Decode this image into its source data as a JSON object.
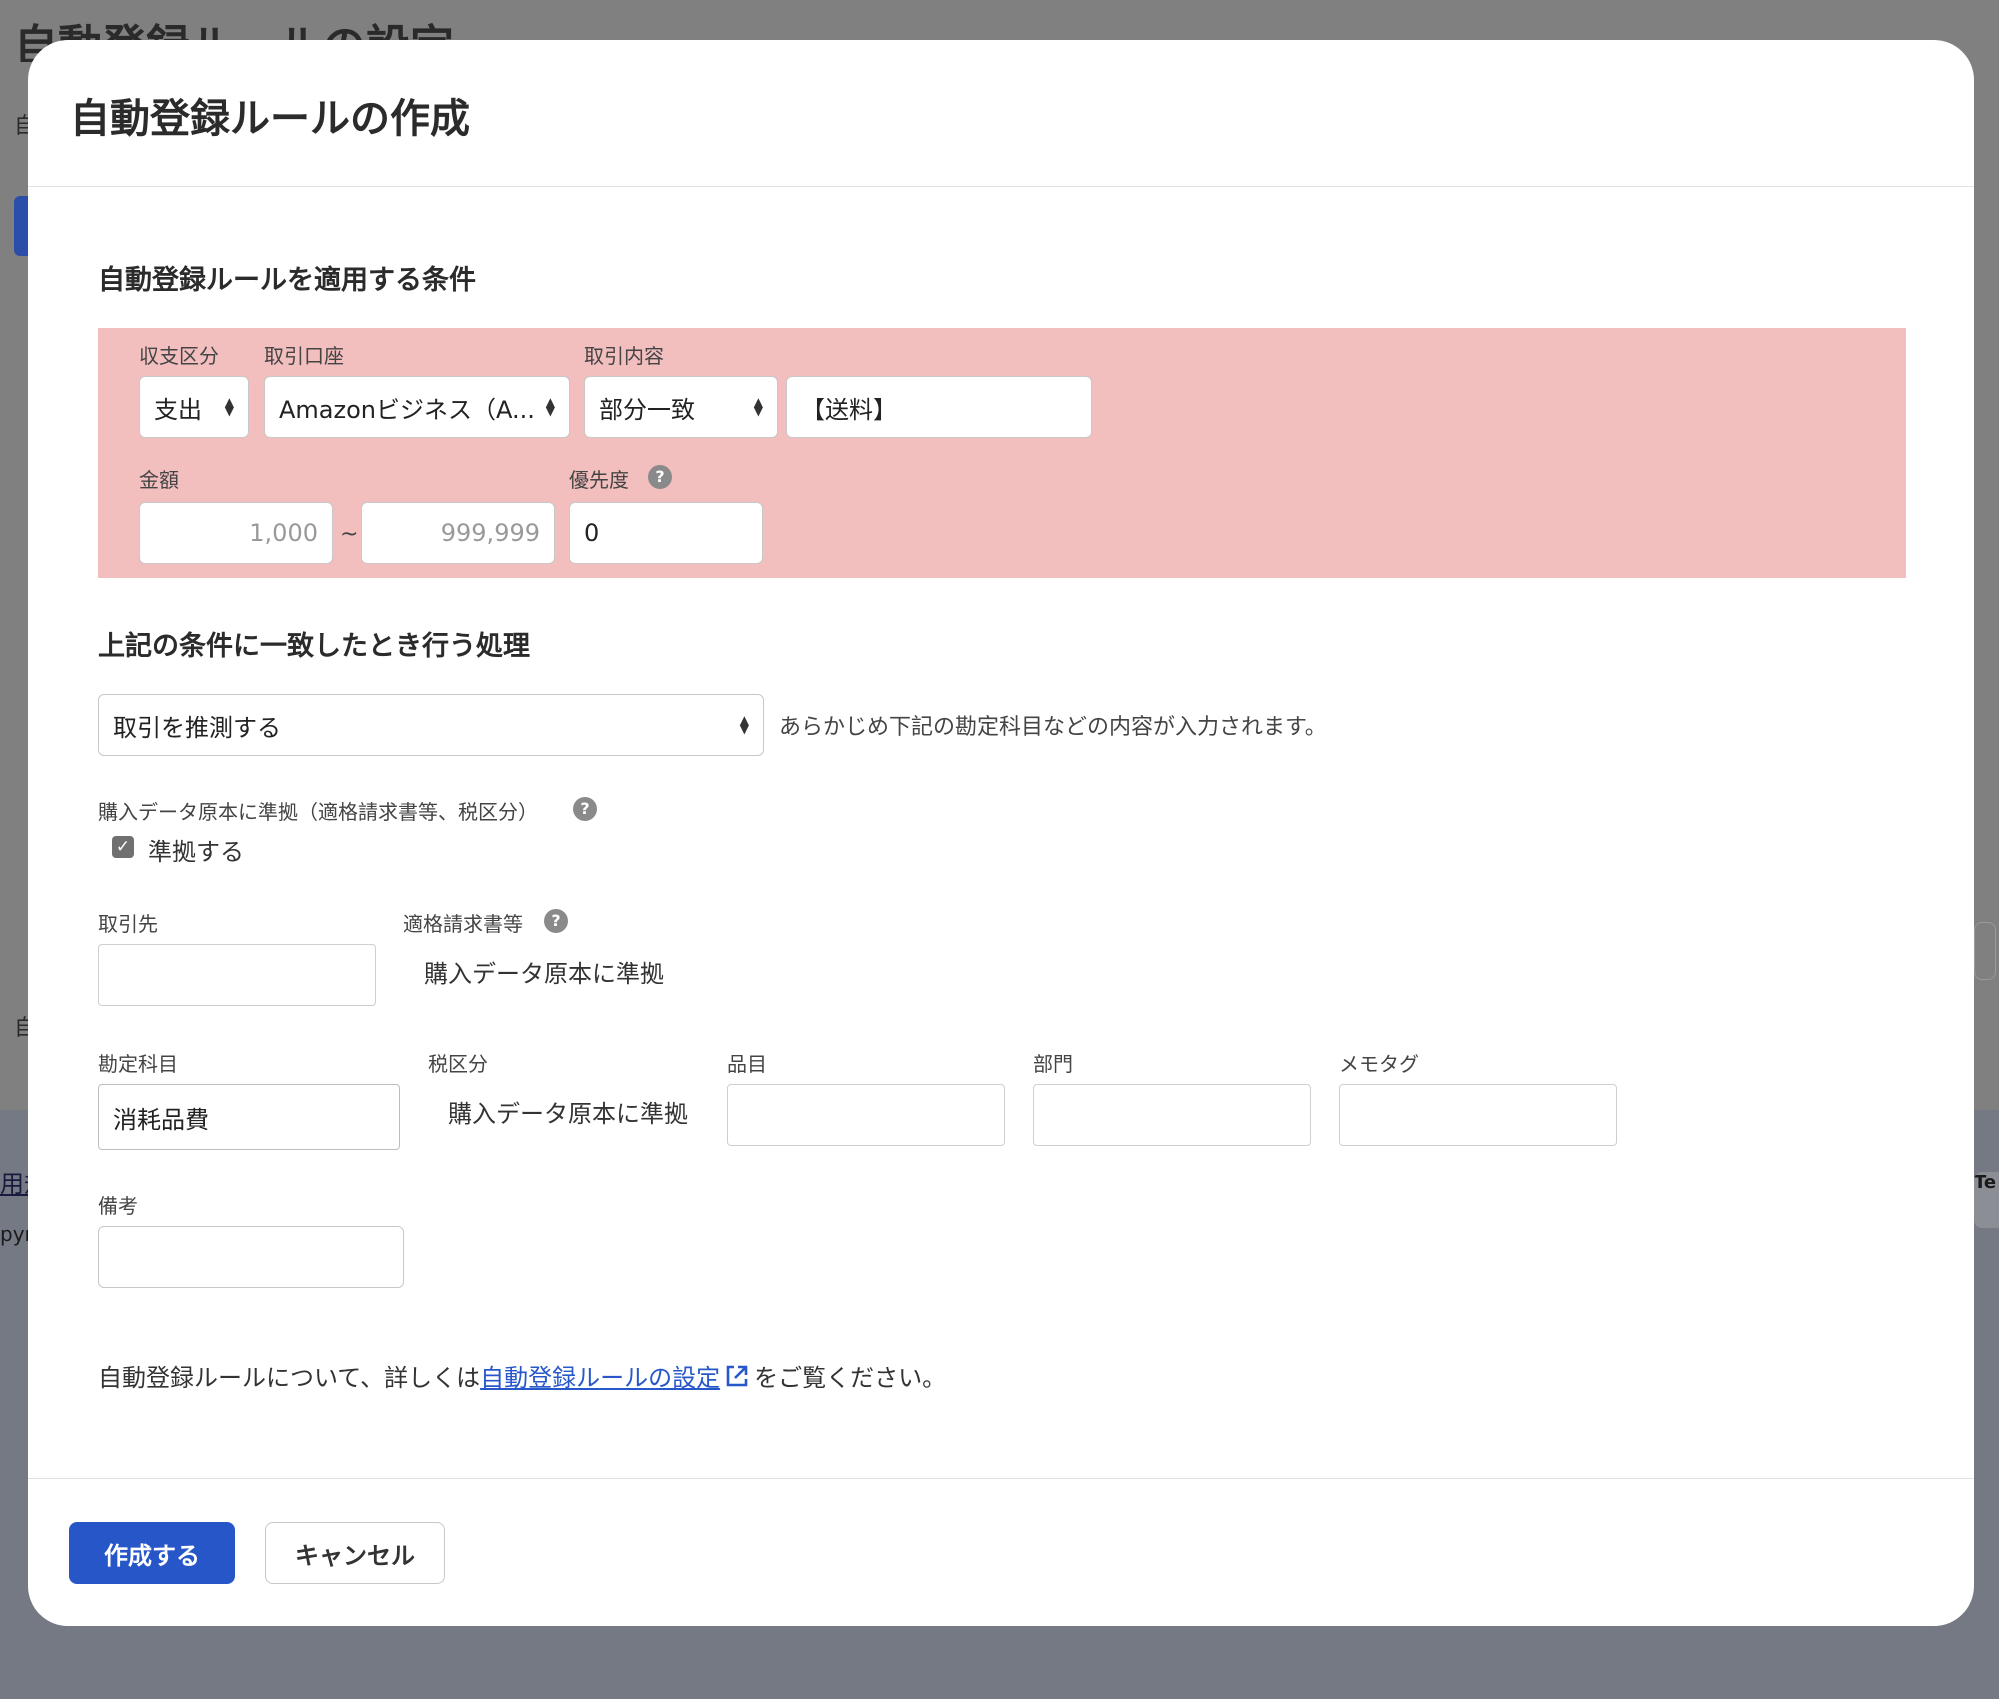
{
  "background": {
    "title": "自動登録ルールの設定",
    "char1": "自",
    "char2": "自",
    "link": "用規",
    "copyright": "pyr",
    "badge": "Te"
  },
  "modal": {
    "title": "自動登録ルールの作成",
    "conditions": {
      "section_title": "自動登録ルールを適用する条件",
      "income_expense": {
        "label": "収支区分",
        "value": "支出"
      },
      "account": {
        "label": "取引口座",
        "value": "Amazonビジネス（A..."
      },
      "content_match": {
        "label": "取引内容",
        "value": "部分一致"
      },
      "content_text": {
        "value": "【送料】"
      },
      "amount": {
        "label": "金額",
        "min_placeholder": "1,000",
        "separator": "~",
        "max_placeholder": "999,999"
      },
      "priority": {
        "label": "優先度",
        "value": "0"
      }
    },
    "action": {
      "section_title": "上記の条件に一致したとき行う処理",
      "select_value": "取引を推測する",
      "note": "あらかじめ下記の勘定科目などの内容が入力されます。",
      "compliance_label": "購入データ原本に準拠（適格請求書等、税区分）",
      "compliance_checkbox_label": "準拠する"
    },
    "fields": {
      "partner_label": "取引先",
      "partner_value": "",
      "invoice_label": "適格請求書等",
      "invoice_value": "購入データ原本に準拠",
      "account_item_label": "勘定科目",
      "account_item_value": "消耗品費",
      "tax_label": "税区分",
      "tax_value": "購入データ原本に準拠",
      "item_label": "品目",
      "item_value": "",
      "department_label": "部門",
      "department_value": "",
      "memo_tag_label": "メモタグ",
      "memo_tag_value": "",
      "remarks_label": "備考",
      "remarks_value": ""
    },
    "info": {
      "prefix": "自動登録ルールについて、詳しくは",
      "link": "自動登録ルールの設定",
      "suffix": "をご覧ください。"
    },
    "footer": {
      "create": "作成する",
      "cancel": "キャンセル"
    }
  },
  "colors": {
    "primary": "#2756c8",
    "condition_bg": "#f2bebe",
    "link": "#2757c9"
  },
  "icons": [
    "help-icon",
    "checkbox-checked-icon",
    "external-link-icon",
    "select-arrows-icon"
  ]
}
